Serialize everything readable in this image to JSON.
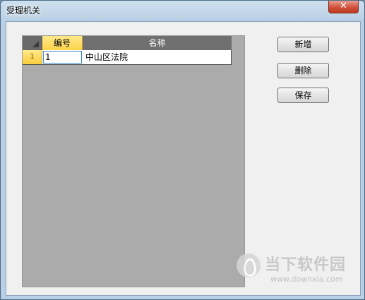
{
  "window": {
    "title": "受理机关",
    "close_glyph": "✕"
  },
  "grid": {
    "columns": [
      "编号",
      "名称"
    ],
    "rows": [
      {
        "row_number": "1",
        "code": "1",
        "name": "中山区法院"
      }
    ]
  },
  "buttons": {
    "add": "新增",
    "delete": "删除",
    "save": "保存"
  },
  "watermark": {
    "text": "当下软件园",
    "url": "www.downxia.com"
  }
}
